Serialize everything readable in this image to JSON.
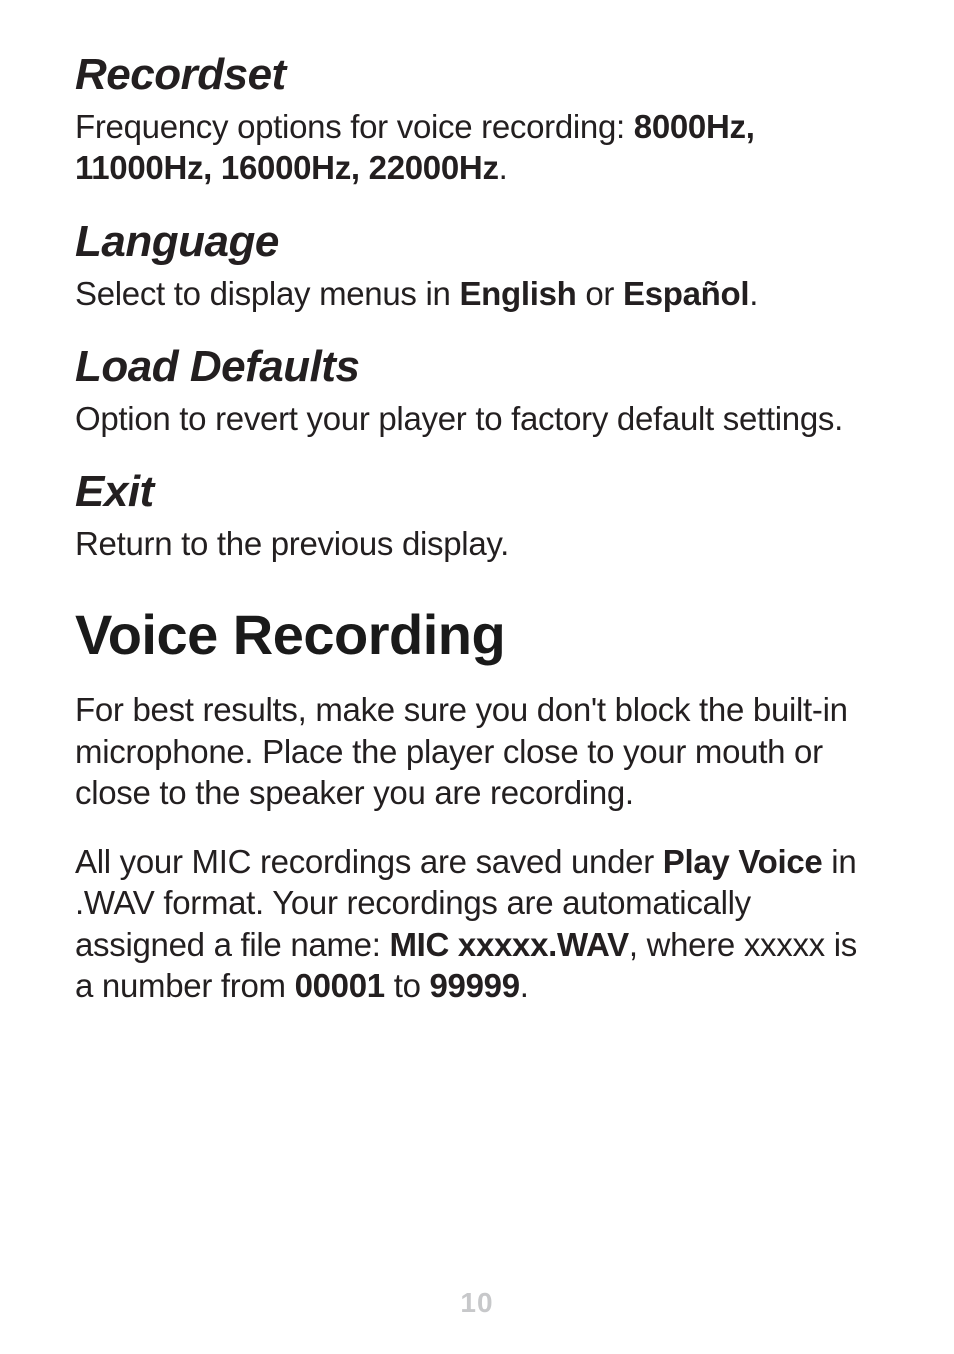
{
  "sections": {
    "recordset": {
      "heading": "Recordset",
      "body_pre": "Frequency options for voice recording: ",
      "body_bold": "8000Hz, 11000Hz, 16000Hz, 22000Hz",
      "body_post": "."
    },
    "language": {
      "heading": "Language",
      "body_pre": "Select to display menus in ",
      "body_bold1": "English",
      "body_mid": " or ",
      "body_bold2": "Español",
      "body_post": "."
    },
    "load_defaults": {
      "heading": "Load Defaults",
      "body": "Option to revert your player to factory default settings."
    },
    "exit": {
      "heading": "Exit",
      "body": "Return to the previous display."
    }
  },
  "main": {
    "heading": "Voice Recording",
    "para1": "For best results, make sure you don't block the built-in microphone. Place the player close to your mouth or close to the speaker you are recording.",
    "para2": {
      "t1": "All your MIC recordings are saved under ",
      "b1": "Play Voice",
      "t2": " in .WAV format. Your recordings are automatically assigned a file name: ",
      "b2": "MIC xxxxx.WAV",
      "t3": ", where xxxxx is a number from ",
      "b3": "00001",
      "t4": " to ",
      "b4": "99999",
      "t5": "."
    }
  },
  "page_number": "10"
}
